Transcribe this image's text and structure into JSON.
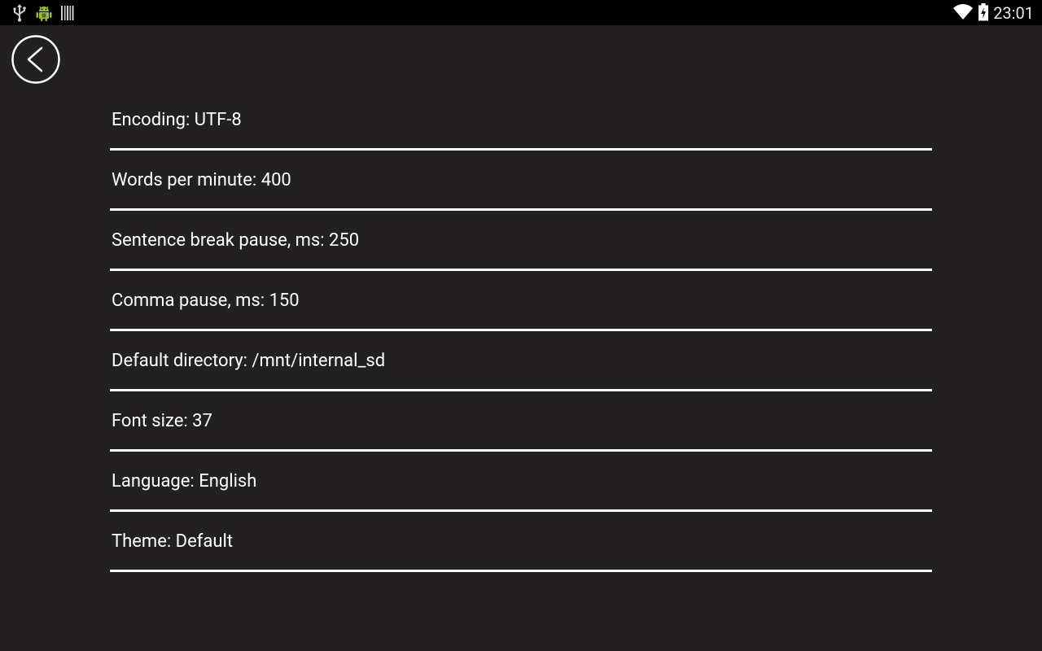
{
  "status_bar": {
    "clock": "23:01",
    "icons_left": [
      "usb-icon",
      "android-debug-icon",
      "barcode-icon"
    ],
    "icons_right": [
      "wifi-icon",
      "battery-charging-icon"
    ]
  },
  "toolbar": {
    "back_icon": "back-arrow-icon"
  },
  "settings": [
    {
      "label": "Encoding: UTF-8"
    },
    {
      "label": "Words per minute: 400"
    },
    {
      "label": "Sentence break pause, ms: 250"
    },
    {
      "label": "Comma pause, ms: 150"
    },
    {
      "label": "Default directory: /mnt/internal_sd"
    },
    {
      "label": "Font size: 37"
    },
    {
      "label": "Language: English"
    },
    {
      "label": "Theme: Default"
    }
  ],
  "colors": {
    "background": "#232022",
    "status_bar": "#000000",
    "text": "#ffffff",
    "divider": "#ffffff",
    "android_green": "#97c024"
  }
}
